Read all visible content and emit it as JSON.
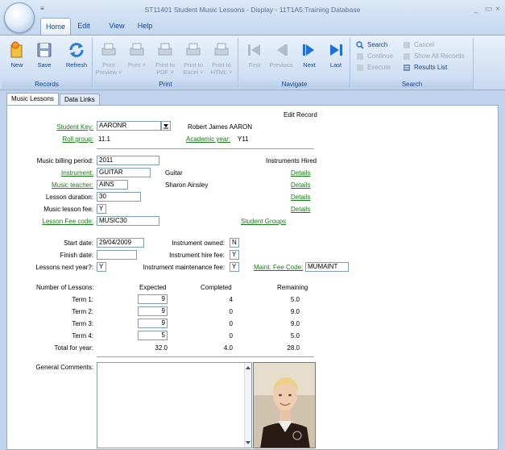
{
  "window": {
    "title": "ST11401 Student Music Lessons - Display - 11T1A5:Training Database",
    "qat": "≡",
    "minimize": "_",
    "restore": "▭",
    "close": "×"
  },
  "menu_tabs": [
    "Home",
    "Edit",
    "View",
    "Help"
  ],
  "ribbon": {
    "records": {
      "label": "Records",
      "new": "New",
      "save": "Save",
      "refresh": "Refresh"
    },
    "print": {
      "label": "Print",
      "print_preview": "Print Preview ˅",
      "print": "Print ˅",
      "print_pdf": "Print to PDF ˅",
      "print_excel": "Print to Excel ˅",
      "print_html": "Print to HTML ˅"
    },
    "navigate": {
      "label": "Navigate",
      "first": "First",
      "previous": "Previous",
      "next": "Next",
      "last": "Last"
    },
    "search": {
      "label": "Search",
      "search": "Search",
      "continue": "Continue",
      "execute": "Execute",
      "cancel": "Cancel",
      "show_all": "Show All Records",
      "results_list": "Results List"
    }
  },
  "doc_tabs": [
    "Music Lessons",
    "Data Links"
  ],
  "form": {
    "mode": "Edit Record",
    "student_key_label": "Student Key:",
    "student_key": "AARONR",
    "student_name": "Robert James AARON",
    "roll_group_label": "Roll group:",
    "roll_group": "11.1",
    "academic_year_label": "Academic year:",
    "academic_year": "Y11",
    "billing_period_label": "Music billing period:",
    "billing_period": "2011",
    "instruments_hired_label": "Instruments Hired",
    "instrument_label": "Instrument:",
    "instrument": "GUITAR",
    "instrument_desc": "Guitar",
    "teacher_label": "Music teacher:",
    "teacher": "AINS",
    "teacher_name": "Sharon Ainsley",
    "duration_label": "Lesson duration:",
    "duration": "30",
    "fee_label": "Music lesson fee:",
    "fee": "Y",
    "fee_code_label": "Lesson Fee code:",
    "fee_code": "MUSIC30",
    "details": [
      "Details",
      "Details",
      "Details",
      "Details"
    ],
    "student_groups": "Student Groups",
    "start_date_label": "Start date:",
    "start_date": "29/04/2009",
    "finish_date_label": "Finish date:",
    "finish_date": "",
    "next_year_label": "Lessons next year?:",
    "next_year": "Y",
    "inst_owned_label": "Instrument owned:",
    "inst_owned": "N",
    "inst_hire_fee_label": "Instrument hire fee:",
    "inst_hire_fee": "Y",
    "inst_maint_label": "Instrument maintenance fee:",
    "inst_maint": "Y",
    "maint_code_label": "Maint. Fee Code:",
    "maint_code": "MUMAINT",
    "lessons": {
      "header": [
        "Number of Lessons:",
        "Expected",
        "Completed",
        "Remaining"
      ],
      "rows": [
        {
          "label": "Term 1:",
          "expected": "9",
          "completed": "4",
          "remaining": "5.0"
        },
        {
          "label": "Term 2:",
          "expected": "9",
          "completed": "0",
          "remaining": "9.0"
        },
        {
          "label": "Term 3:",
          "expected": "9",
          "completed": "0",
          "remaining": "9.0"
        },
        {
          "label": "Term 4:",
          "expected": "5",
          "completed": "0",
          "remaining": "5.0"
        }
      ],
      "total": {
        "label": "Total for year:",
        "expected": "32.0",
        "completed": "4.0",
        "remaining": "28.0"
      }
    },
    "comments_label": "General Comments:",
    "comments": ""
  }
}
